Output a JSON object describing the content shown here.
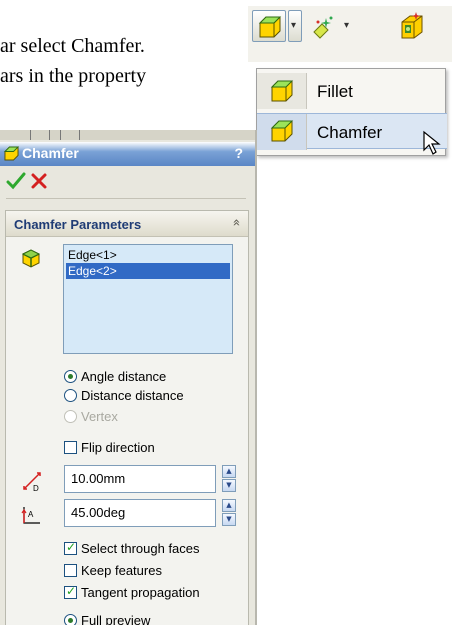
{
  "document": {
    "line1": "ar select Chamfer.",
    "line2": "ars in the property"
  },
  "toolbar": {
    "fillet_dropdown_arrow": "▾",
    "feature_dropdown_arrow": "▾"
  },
  "menu": {
    "items": [
      {
        "label": "Fillet",
        "icon": "fillet-icon"
      },
      {
        "label": "Chamfer",
        "icon": "chamfer-icon",
        "highlighted": true
      }
    ]
  },
  "panel": {
    "title": "Chamfer",
    "help": "?",
    "ok_icon": "ok-check-icon",
    "cancel_icon": "cancel-x-icon",
    "group": {
      "title": "Chamfer Parameters",
      "collapse_icon": "«",
      "selection": [
        "Edge<1>",
        "Edge<2>"
      ],
      "selected_index": 1,
      "options": {
        "angle_distance": "Angle distance",
        "distance_distance": "Distance distance",
        "vertex": "Vertex",
        "selected": "angle_distance"
      },
      "flip_direction": {
        "label": "Flip direction",
        "checked": false
      },
      "distance": {
        "value": "10.00mm"
      },
      "angle": {
        "value": "45.00deg"
      },
      "select_through_faces": {
        "label": "Select through faces",
        "checked": true
      },
      "keep_features": {
        "label": "Keep features",
        "checked": false
      },
      "tangent_propagation": {
        "label": "Tangent propagation",
        "checked": true
      },
      "full_preview": {
        "label": "Full preview",
        "selected": true
      }
    },
    "spin_up": "▲",
    "spin_down": "▼"
  },
  "colors": {
    "selection_bg": "#d6e9f8",
    "highlight": "#316ac5",
    "title_blue": "#5a86c5"
  }
}
